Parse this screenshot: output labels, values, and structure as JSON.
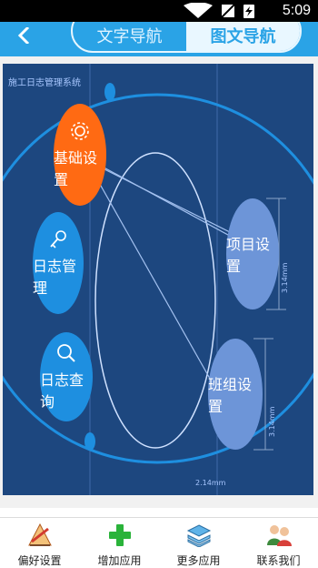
{
  "status": {
    "time": "5:09"
  },
  "header": {
    "tab_left": "文字导航",
    "tab_right": "图文导航"
  },
  "diagram": {
    "title": "施工日志管理系统",
    "nodes": {
      "basic": "基础设置",
      "log_manage": "日志管理",
      "log_query": "日志查询",
      "project": "项目设置",
      "team": "班组设置"
    },
    "dims": {
      "project_dim": "3.14mm",
      "team_dim": "3.14mm",
      "bottom_dim": "2.14mm"
    },
    "colors": {
      "basic": "#ff6a13",
      "left_nodes": "#1e8fe0",
      "right_nodes": "#6d95d8",
      "canvas_bg": "#1d477f"
    }
  },
  "bottom_nav": [
    {
      "label": "偏好设置",
      "icon": "pencil-ruler-icon"
    },
    {
      "label": "增加应用",
      "icon": "plus-icon"
    },
    {
      "label": "更多应用",
      "icon": "stack-icon"
    },
    {
      "label": "联系我们",
      "icon": "contacts-icon"
    }
  ]
}
